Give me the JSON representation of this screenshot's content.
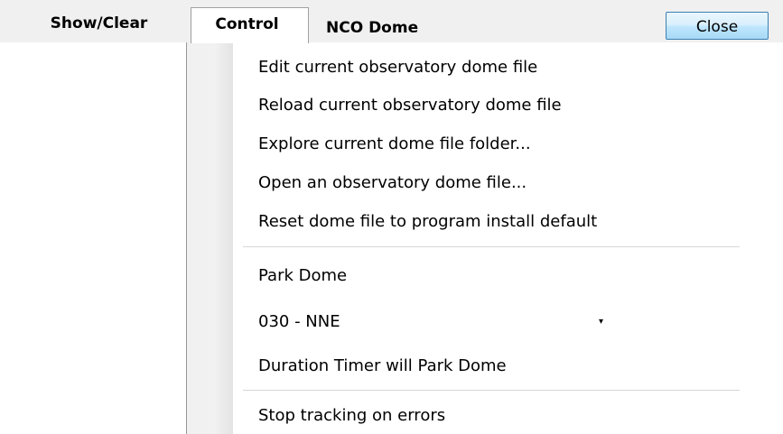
{
  "menubar": {
    "show_clear": "Show/Clear",
    "control": "Control",
    "nco_dome": "NCO Dome",
    "close": "Close"
  },
  "dropdown": {
    "items": [
      "Edit current observatory dome file",
      "Reload current observatory dome file",
      "Explore current dome file folder...",
      "Open an observatory dome file...",
      "Reset dome file to program install default"
    ],
    "park_label": "Park Dome",
    "park_select": {
      "value": "030 - NNE",
      "arrow": "▾"
    },
    "duration_timer": "Duration Timer will Park Dome",
    "stop_tracking": "Stop tracking on errors"
  },
  "icons": {
    "dropdown_arrow": "chevron-down-icon"
  }
}
